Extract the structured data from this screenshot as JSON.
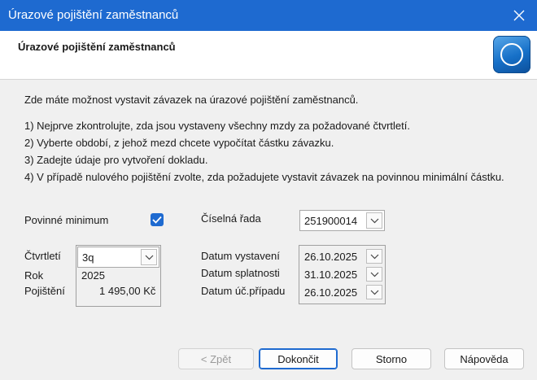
{
  "window": {
    "title": "Úrazové pojištění zaměstnanců"
  },
  "header": {
    "title": "Úrazové pojištění zaměstnanců"
  },
  "intro": "Zde máte možnost vystavit závazek na úrazové pojištění zaměstnanců.",
  "steps": [
    "1) Nejprve zkontrolujte, zda jsou vystaveny všechny mzdy za požadované čtvrtletí.",
    "2) Vyberte období, z jehož mezd chcete vypočítat částku závazku.",
    "3) Zadejte údaje pro vytvoření dokladu.",
    "4) V případě nulového pojištění zvolte, zda požadujete vystavit závazek na povinnou minimální částku."
  ],
  "form": {
    "minimum_label": "Povinné minimum",
    "minimum_checked": true,
    "series_label": "Číselná řada",
    "series_value": "251900014",
    "quarter_label": "Čtvrtletí",
    "quarter_value": "3q",
    "year_label": "Rok",
    "year_value": "2025",
    "insurance_label": "Pojištění",
    "insurance_value": "1 495,00 Kč",
    "issue_date_label": "Datum vystavení",
    "issue_date_value": "26.10.2025",
    "due_date_label": "Datum splatnosti",
    "due_date_value": "31.10.2025",
    "accounting_date_label": "Datum úč.případu",
    "accounting_date_value": "26.10.2025"
  },
  "buttons": {
    "back": "< Zpět",
    "finish": "Dokončit",
    "cancel": "Storno",
    "help": "Nápověda"
  },
  "colors": {
    "accent": "#1e6ad0"
  }
}
